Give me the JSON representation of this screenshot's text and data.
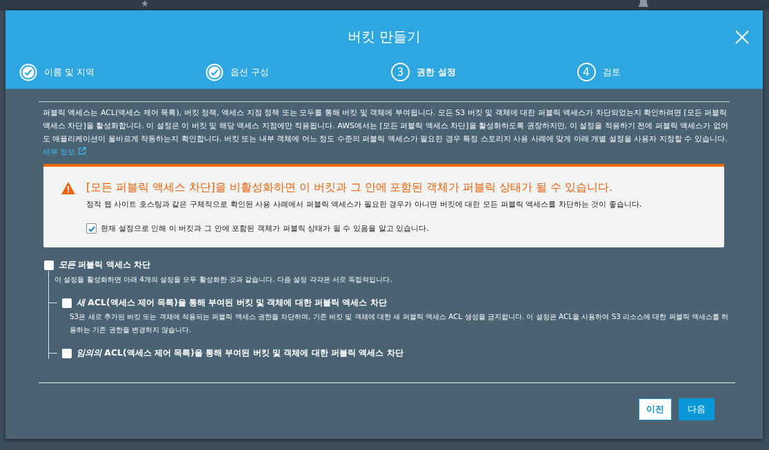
{
  "modal": {
    "title": "버킷 만들기",
    "steps": [
      {
        "label": "이름 및 지역",
        "done": true,
        "selected": false
      },
      {
        "label": "옵션 구성",
        "done": true,
        "selected": false
      },
      {
        "number": "3",
        "label": "권한 설정",
        "done": false,
        "selected": true
      },
      {
        "number": "4",
        "label": "검토",
        "done": false,
        "selected": false
      }
    ],
    "intro": "퍼블릭 액세스는 ACL(액세스 제어 목록), 버킷 정책, 액세스 지점 정책 또는 모두를 통해 버킷 및 객체에 부여됩니다. 모든 S3 버킷 및 객체에 대한 퍼블릭 액세스가 차단되었는지 확인하려면 [모든 퍼블릭 액세스 차단]을 활성화합니다. 이 설정은 이 버킷 및 해당 액세스 지점에만 적용됩니다. AWS에서는 [모든 퍼블릭 액세스 차단]을 활성화하도록 권장하지만, 이 설정을 적용하기 전에 퍼블릭 액세스가 없어도 애플리케이션이 올바르게 작동하는지 확인합니다. 버킷 또는 내부 객체에 어느 정도 수준의 퍼블릭 액세스가 필요한 경우 특정 스토리지 사용 사례에 맞게 아래 개별 설정을 사용자 지정할 수 있습니다.",
    "intro_link": "세부 정보",
    "warning": {
      "title": "[모든 퍼블릭 액세스 차단]을 비활성화하면 이 버킷과 그 안에 포함된 객체가 퍼블릭 상태가 될 수 있습니다.",
      "text": "정적 웹 사이트 호스팅과 같은 구체적으로 확인된 사용 사례에서 퍼블릭 액세스가 필요한 경우가 아니면 버킷에 대한 모든 퍼블릭 액세스를 차단하는 것이 좋습니다.",
      "acknowledge": {
        "label": "현재 설정으로 인해 이 버킷과 그 안에 포함된 객체가 퍼블릭 상태가 될 수 있음을 알고 있습니다.",
        "checked": true
      }
    },
    "block_all": {
      "label": "*모든* 퍼블릭 액세스 차단",
      "checked": false,
      "description": "이 설정을 활성화하면 아래 4개의 설정을 모두 활성화한 것과 같습니다. 다음 설정 각각은 서로 독립적입니다.",
      "children": [
        {
          "label": "*새* ACL(액세스 제어 목록)을 통해 부여된 버킷 및 객체에 대한 퍼블릭 액세스 차단",
          "checked": false,
          "description": "S3은 새로 추가된 버킷 또는 객체에 적용되는 퍼블릭 액세스 권한을 차단하며, 기존 버킷 및 객체에 대한 새 퍼블릭 액세스 ACL 생성을 금지합니다. 이 설정은 ACL을 사용하여 S3 리소스에 대한 퍼블릭 액세스를 허용하는 기존 권한을 변경하지 않습니다."
        },
        {
          "label": "*임의의* ACL(액세스 제어 목록)을 통해 부여된 버킷 및 객체에 대한 퍼블릭 액세스 차단",
          "checked": false
        }
      ]
    },
    "buttons": [
      {
        "label": "이전",
        "kind": "secondary"
      },
      {
        "label": "다음",
        "kind": "primary"
      }
    ]
  }
}
